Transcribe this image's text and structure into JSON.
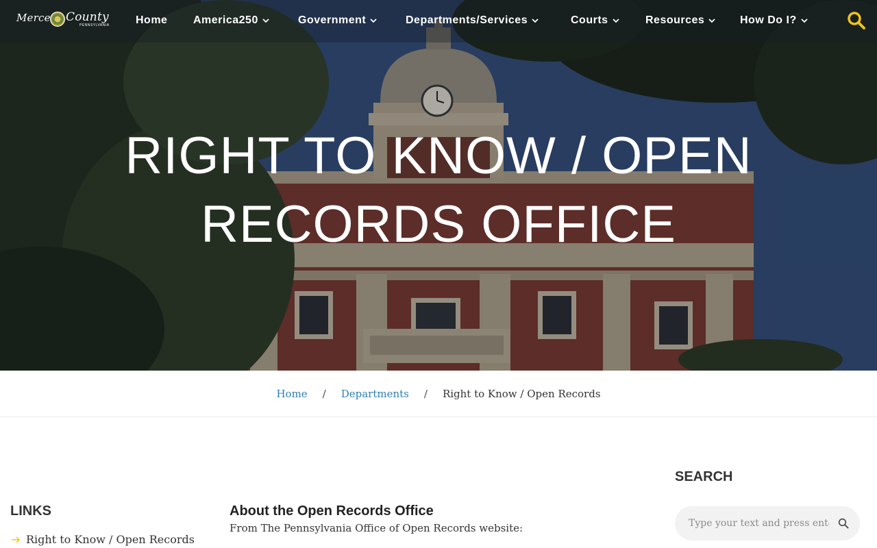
{
  "nav": {
    "logo_text_left": "Mercer",
    "logo_text_right": "County",
    "logo_subtext": "PENNSYLVANIA",
    "items": [
      {
        "label": "Home",
        "has_dropdown": false
      },
      {
        "label": "America250",
        "has_dropdown": true
      },
      {
        "label": "Government",
        "has_dropdown": true
      },
      {
        "label": "Departments/Services",
        "has_dropdown": true
      },
      {
        "label": "Courts",
        "has_dropdown": true
      },
      {
        "label": "Resources",
        "has_dropdown": true
      },
      {
        "label": "How Do I?",
        "has_dropdown": true
      }
    ],
    "search_icon": "search-icon",
    "accent_color": "#f2c21b"
  },
  "hero": {
    "title_line1": "RIGHT TO KNOW / OPEN",
    "title_line2": "RECORDS OFFICE"
  },
  "breadcrumb": {
    "items": [
      "Home",
      "Departments"
    ],
    "separator": "/",
    "current": "Right to Know / Open Records",
    "link_color": "#2f7fb5"
  },
  "sidebar": {
    "heading": "LINKS",
    "links": [
      "Right to Know / Open Records"
    ],
    "arrow_color": "#f2c21b"
  },
  "main": {
    "heading": "About the Open Records Office",
    "intro": "From The Pennsylvania Office of Open Records website:"
  },
  "search": {
    "heading": "SEARCH",
    "placeholder": "Type your text and press enter"
  }
}
